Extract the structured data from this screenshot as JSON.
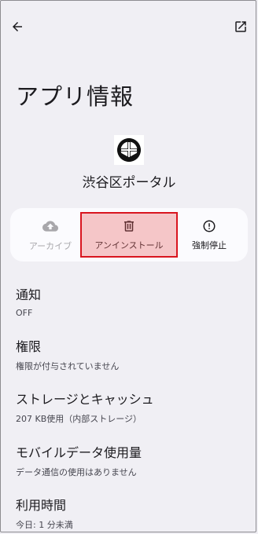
{
  "screen": {
    "title": "アプリ情報"
  },
  "icons": {
    "back": "arrow-left-icon",
    "open": "open-in-new-icon",
    "archive": "cloud-upload-icon",
    "uninstall": "trash-icon",
    "force_stop": "alert-circle-icon"
  },
  "app": {
    "name": "渋谷区ポータル",
    "icon": "shibuya-emblem"
  },
  "actions": {
    "archive_label": "アーカイブ",
    "uninstall_label": "アンインストール",
    "force_stop_label": "強制停止"
  },
  "settings": [
    {
      "title": "通知",
      "subtitle": "OFF"
    },
    {
      "title": "権限",
      "subtitle": "権限が付与されていません"
    },
    {
      "title": "ストレージとキャッシュ",
      "subtitle": "207 KB使用（内部ストレージ）"
    },
    {
      "title": "モバイルデータ使用量",
      "subtitle": "データ通信の使用はありません"
    },
    {
      "title": "利用時間",
      "subtitle": "今日: 1 分未満"
    }
  ],
  "colors": {
    "background": "#f0eff4",
    "highlight_border": "#d9151f",
    "disabled_text": "#a8a7ab"
  }
}
